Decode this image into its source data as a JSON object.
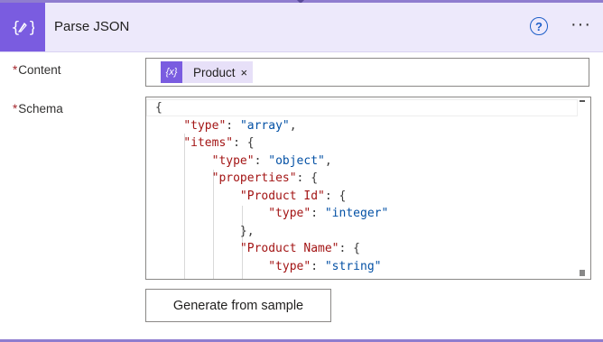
{
  "action": {
    "title": "Parse JSON",
    "icon": "braces-icon",
    "help_label": "?",
    "more_label": "···",
    "color": "#7a5ce0"
  },
  "fields": {
    "content": {
      "required_mark": "*",
      "label": "Content",
      "token": {
        "icon_text": "{x}",
        "label": "Product",
        "remove": "×"
      }
    },
    "schema": {
      "required_mark": "*",
      "label": "Schema",
      "lines": [
        "{",
        "    \"type\": \"array\",",
        "    \"items\": {",
        "        \"type\": \"object\",",
        "        \"properties\": {",
        "            \"Product Id\": {",
        "                \"type\": \"integer\"",
        "            },",
        "            \"Product Name\": {",
        "                \"type\": \"string\""
      ]
    }
  },
  "buttons": {
    "generate": "Generate from sample"
  }
}
